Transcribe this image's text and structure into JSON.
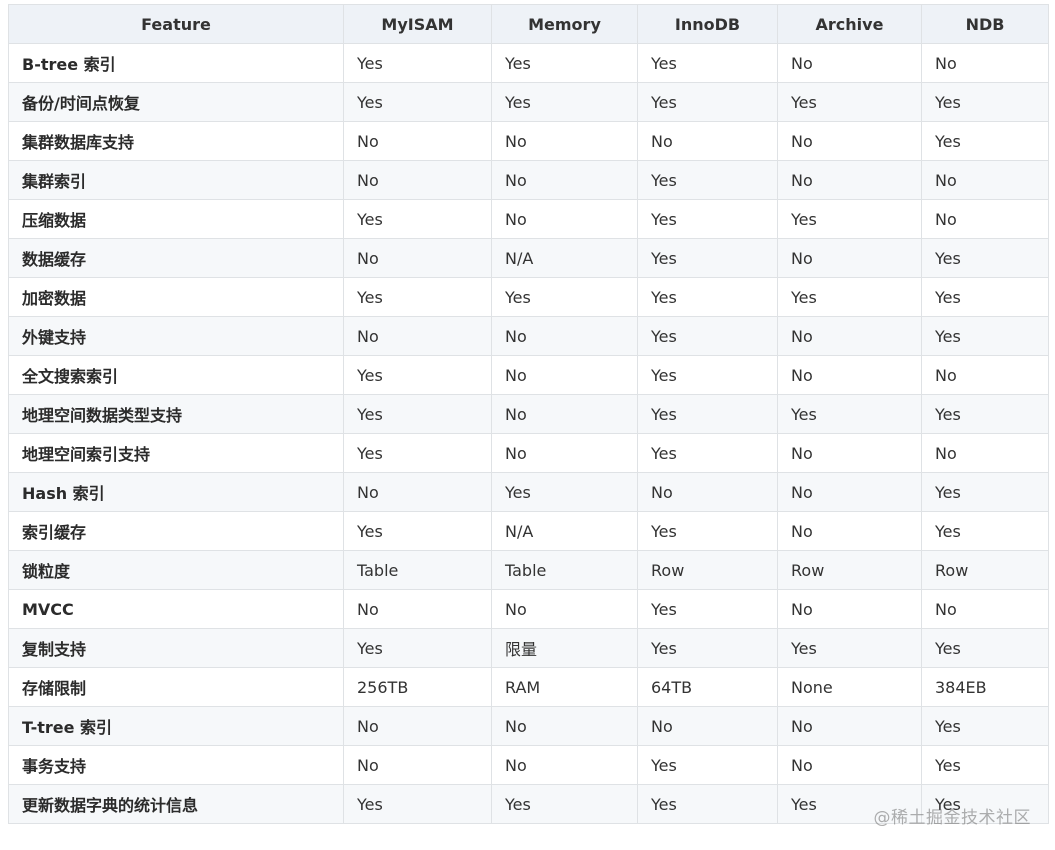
{
  "table": {
    "headers": [
      "Feature",
      "MyISAM",
      "Memory",
      "InnoDB",
      "Archive",
      "NDB"
    ],
    "rows": [
      [
        "B-tree 索引",
        "Yes",
        "Yes",
        "Yes",
        "No",
        "No"
      ],
      [
        "备份/时间点恢复",
        "Yes",
        "Yes",
        "Yes",
        "Yes",
        "Yes"
      ],
      [
        "集群数据库支持",
        "No",
        "No",
        "No",
        "No",
        "Yes"
      ],
      [
        "集群索引",
        "No",
        "No",
        "Yes",
        "No",
        "No"
      ],
      [
        "压缩数据",
        "Yes",
        "No",
        "Yes",
        "Yes",
        "No"
      ],
      [
        "数据缓存",
        "No",
        "N/A",
        "Yes",
        "No",
        "Yes"
      ],
      [
        "加密数据",
        "Yes",
        "Yes",
        "Yes",
        "Yes",
        "Yes"
      ],
      [
        "外键支持",
        "No",
        "No",
        "Yes",
        "No",
        "Yes"
      ],
      [
        "全文搜索索引",
        "Yes",
        "No",
        "Yes",
        "No",
        "No"
      ],
      [
        "地理空间数据类型支持",
        "Yes",
        "No",
        "Yes",
        "Yes",
        "Yes"
      ],
      [
        "地理空间索引支持",
        "Yes",
        "No",
        "Yes",
        "No",
        "No"
      ],
      [
        "Hash 索引",
        "No",
        "Yes",
        "No",
        "No",
        "Yes"
      ],
      [
        "索引缓存",
        "Yes",
        "N/A",
        "Yes",
        "No",
        "Yes"
      ],
      [
        "锁粒度",
        "Table",
        "Table",
        "Row",
        "Row",
        "Row"
      ],
      [
        "MVCC",
        "No",
        "No",
        "Yes",
        "No",
        "No"
      ],
      [
        "复制支持",
        "Yes",
        "限量",
        "Yes",
        "Yes",
        "Yes"
      ],
      [
        "存储限制",
        "256TB",
        "RAM",
        "64TB",
        "None",
        "384EB"
      ],
      [
        "T-tree 索引",
        "No",
        "No",
        "No",
        "No",
        "Yes"
      ],
      [
        "事务支持",
        "No",
        "No",
        "Yes",
        "No",
        "Yes"
      ],
      [
        "更新数据字典的统计信息",
        "Yes",
        "Yes",
        "Yes",
        "Yes",
        "Yes"
      ]
    ]
  },
  "watermark": "@稀土掘金技术社区"
}
